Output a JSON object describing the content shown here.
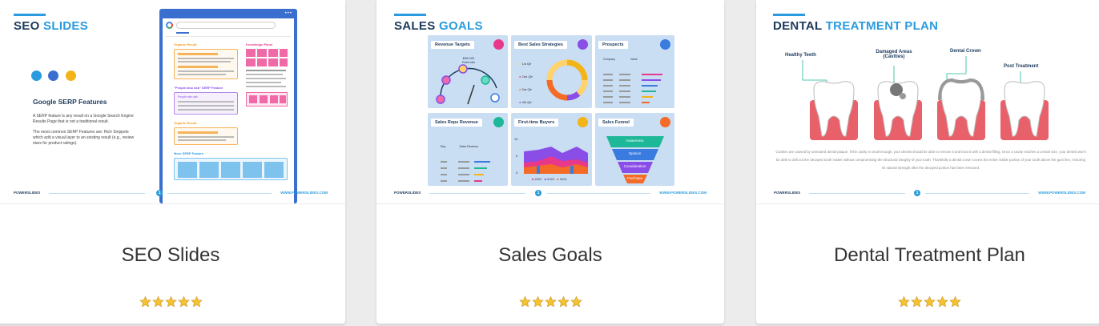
{
  "cards": [
    {
      "title": "SEO Slides",
      "rating": 5,
      "slide": {
        "heading_dark": "SEO",
        "heading_accent": "SLIDES",
        "subtitle": "Google SERP Features",
        "paragraph_1": "A SERP feature is any result on a Google Search Engine Results Page that is not a traditional result.",
        "paragraph_2": "The most common SERP Features are: Rich Snippets which add a visual layer to an existing result (e.g., review stars for product ratings).",
        "labels": [
          "Organic Result",
          "Knowledge Panel",
          "\"People also ask\" SERP Feature",
          "People also ask",
          "Organic Result",
          "More SERP Feature"
        ],
        "footer_left": "POWERSLIDES",
        "footer_right": "WWW.POWERSLIDES.COM",
        "page_number": "1"
      }
    },
    {
      "title": "Sales Goals",
      "rating": 5,
      "slide": {
        "heading_dark": "SALES",
        "heading_accent": "GOALS",
        "panels": [
          {
            "title": "Revenue Targets",
            "icon_color": "#e8388a"
          },
          {
            "title": "Best Sales Strategies",
            "icon_color": "#8a4de8"
          },
          {
            "title": "Prospects",
            "icon_color": "#3a7be0"
          },
          {
            "title": "Sales Reps Revenue",
            "icon_color": "#1db897"
          },
          {
            "title": "First-time Buyers",
            "icon_color": "#f2b418"
          },
          {
            "title": "Sales Funnel",
            "icon_color": "#f46a27"
          }
        ],
        "gauge_value": "$38,000",
        "gauge_sub": "Referrals",
        "quarters": [
          "1st Qtr",
          "2nd Qtr",
          "3rd Qtr",
          "4th Qtr"
        ],
        "prospect_headers": [
          "Company",
          "Value"
        ],
        "rep_headers": [
          "Rep",
          "Sales Revenue"
        ],
        "buyers_years": [
          "2022",
          "2023",
          "2024"
        ],
        "buyers_axis": [
          "10",
          "5",
          "0"
        ],
        "funnel": [
          "Awareness",
          "Opinion",
          "Consideration",
          "Purchase"
        ],
        "footer_left": "POWERSLIDES",
        "footer_right": "WWW.POWERSLIDES.COM",
        "page_number": "1"
      }
    },
    {
      "title": "Dental Treatment Plan",
      "rating": 5,
      "slide": {
        "heading_dark": "DENTAL",
        "heading_accent": "TREATMENT PLAN",
        "teeth_labels": [
          "Healthy Teeth",
          "Damaged Areas (Cavities)",
          "Dental Crown",
          "Post Treatment"
        ],
        "paragraph": "Cavities are caused by untreated dental plaque. If the cavity is small enough, your dentist should be able to remove it and treat it with a dental filling. Once a cavity reaches a certain size, your dentist won't be able to drill out the decayed tooth matter without compromising the structural integrity of your tooth. Thankfully a dental crown covers the entire visible portion of your tooth above the gum line, restoring its natural strength after the decayed portion has been removed.",
        "footer_left": "POWERSLIDES",
        "footer_right": "WWW.POWERSLIDES.COM",
        "page_number": "1"
      }
    }
  ],
  "colors": {
    "accent": "#2a9bde",
    "navy": "#1d3a5c",
    "star": "#f5c330",
    "panel": "#c9ddf3",
    "gum": "#e8606a"
  }
}
